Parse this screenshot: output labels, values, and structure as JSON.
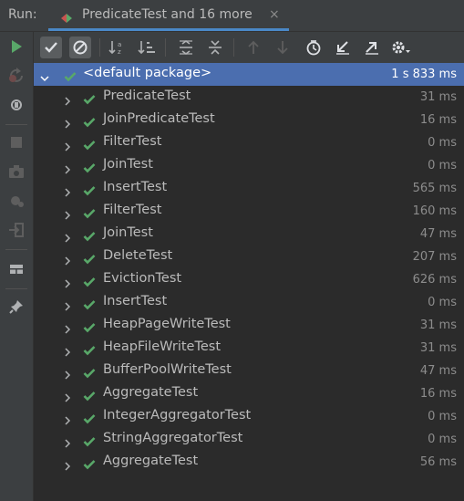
{
  "run_label": "Run:",
  "tab": {
    "title": "PredicateTest and 16 more",
    "close": "×"
  },
  "root": {
    "name": "<default package>",
    "time": "1 s 833 ms"
  },
  "tests": [
    {
      "name": "PredicateTest",
      "time": "31 ms"
    },
    {
      "name": "JoinPredicateTest",
      "time": "16 ms"
    },
    {
      "name": "FilterTest",
      "time": "0 ms"
    },
    {
      "name": "JoinTest",
      "time": "0 ms"
    },
    {
      "name": "InsertTest",
      "time": "565 ms"
    },
    {
      "name": "FilterTest",
      "time": "160 ms"
    },
    {
      "name": "JoinTest",
      "time": "47 ms"
    },
    {
      "name": "DeleteTest",
      "time": "207 ms"
    },
    {
      "name": "EvictionTest",
      "time": "626 ms"
    },
    {
      "name": "InsertTest",
      "time": "0 ms"
    },
    {
      "name": "HeapPageWriteTest",
      "time": "31 ms"
    },
    {
      "name": "HeapFileWriteTest",
      "time": "31 ms"
    },
    {
      "name": "BufferPoolWriteTest",
      "time": "47 ms"
    },
    {
      "name": "AggregateTest",
      "time": "16 ms"
    },
    {
      "name": "IntegerAggregatorTest",
      "time": "0 ms"
    },
    {
      "name": "StringAggregatorTest",
      "time": "0 ms"
    },
    {
      "name": "AggregateTest",
      "time": "56 ms"
    }
  ],
  "colors": {
    "pass": "#59a869",
    "selection": "#4b6eaf",
    "accent": "#4a88c7"
  },
  "sidebar_icons": [
    "rerun-icon",
    "rerun-failed-icon",
    "toggle-auto-test-icon",
    "stop-icon",
    "snapshot-icon",
    "debug-icon",
    "exit-icon",
    "layout-icon",
    "pin-icon"
  ],
  "toolbar_icons": [
    "show-passed-icon",
    "show-ignored-icon",
    "sort-alphabetically-icon",
    "sort-by-duration-icon",
    "expand-all-icon",
    "collapse-all-icon",
    "previous-test-icon",
    "next-test-icon",
    "test-history-icon",
    "import-tests-icon",
    "export-results-icon",
    "settings-icon"
  ]
}
